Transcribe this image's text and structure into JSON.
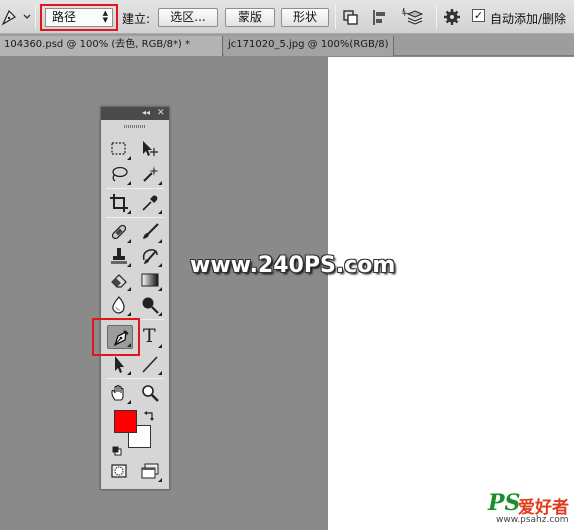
{
  "options_bar": {
    "path_mode": "路径",
    "make_label": "建立:",
    "selection_button": "选区...",
    "mask_button": "蒙版",
    "shape_button": "形状",
    "auto_add_delete_checked": true,
    "auto_add_delete_label": "自动添加/删除"
  },
  "tabs": [
    {
      "label": "104360.psd @ 100% (去色, RGB/8*) *",
      "active": true
    },
    {
      "label": "jc171020_5.jpg @ 100%(RGB/8)",
      "active": false
    }
  ],
  "tools_panel": {
    "active_tool": "pen-tool",
    "tools": [
      "marquee",
      "move",
      "lasso",
      "magic-wand",
      "crop",
      "eyedropper",
      "healing-brush",
      "brush",
      "clone-stamp",
      "history-brush",
      "eraser",
      "gradient",
      "blur",
      "dodge",
      "pen",
      "type",
      "path-selection",
      "line",
      "hand",
      "zoom"
    ],
    "type_glyph": "T"
  },
  "colors": {
    "foreground": "#ff0000",
    "background": "#ffffff",
    "highlight_box": "#e3141a"
  },
  "watermark": {
    "url": "www.240PS.com",
    "logo_ps": "PS",
    "logo_cn": "爱好者",
    "logo_url": "www.psahz.com"
  }
}
